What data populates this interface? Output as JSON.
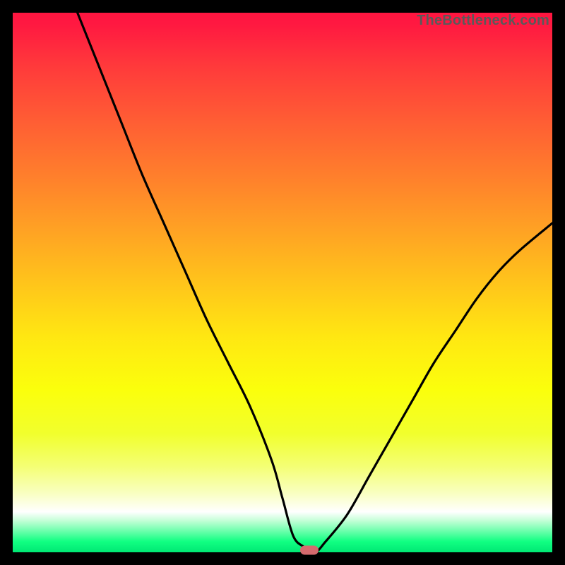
{
  "watermark": "TheBottleneck.com",
  "colors": {
    "page_bg": "#000000",
    "curve": "#000000",
    "marker": "#d66a6e",
    "gradient_top": "#ff1540",
    "gradient_bottom": "#00e874"
  },
  "chart_data": {
    "type": "line",
    "title": "",
    "xlabel": "",
    "ylabel": "",
    "xlim": [
      0,
      100
    ],
    "ylim": [
      0,
      100
    ],
    "grid": false,
    "legend": false,
    "series": [
      {
        "name": "bottleneck-curve",
        "x": [
          12,
          16,
          20,
          24,
          28,
          32,
          36,
          40,
          44,
          48,
          50,
          52,
          54,
          56,
          58,
          62,
          66,
          70,
          74,
          78,
          82,
          86,
          90,
          94,
          100
        ],
        "values": [
          100,
          90,
          80,
          70,
          61,
          52,
          43,
          35,
          27,
          17,
          10,
          3,
          1,
          0,
          2,
          7,
          14,
          21,
          28,
          35,
          41,
          47,
          52,
          56,
          61
        ]
      }
    ],
    "marker": {
      "x": 55,
      "y": 0
    },
    "background_gradient": {
      "direction": "vertical",
      "stops": [
        {
          "pos": 0,
          "color": "#ff1540"
        },
        {
          "pos": 50,
          "color": "#ffc41b"
        },
        {
          "pos": 90,
          "color": "#ffffff"
        },
        {
          "pos": 100,
          "color": "#00e874"
        }
      ]
    }
  }
}
